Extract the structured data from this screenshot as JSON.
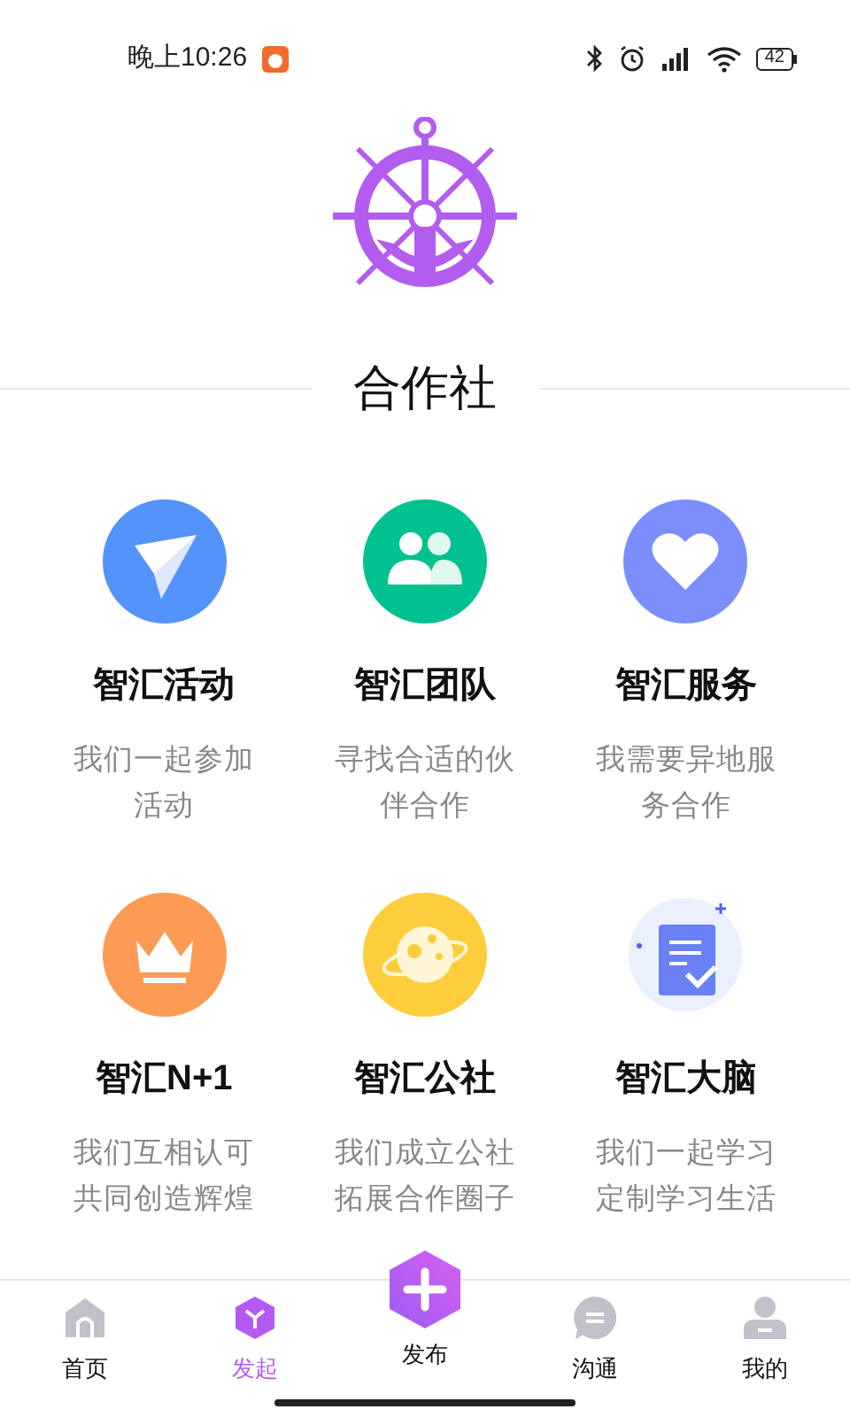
{
  "status_bar": {
    "time": "晚上10:26",
    "battery": "42"
  },
  "header": {
    "title": "合作社"
  },
  "features": [
    {
      "title": "智汇活动",
      "description": "我们一起参加活动"
    },
    {
      "title": "智汇团队",
      "description": "寻找合适的伙伴合作"
    },
    {
      "title": "智汇服务",
      "description": "我需要异地服务合作"
    },
    {
      "title": "智汇N+1",
      "description": "我们互相认可共同创造辉煌"
    },
    {
      "title": "智汇公社",
      "description": "我们成立公社拓展合作圈子"
    },
    {
      "title": "智汇大脑",
      "description": "我们一起学习定制学习生活"
    }
  ],
  "tab_bar": [
    {
      "kind": "home",
      "label": "首页",
      "selected": false
    },
    {
      "kind": "launch",
      "label": "发起",
      "selected": true
    },
    {
      "kind": "publish",
      "label": "发布",
      "selected": false
    },
    {
      "kind": "chat",
      "label": "沟通",
      "selected": false
    },
    {
      "kind": "profile",
      "label": "我的",
      "selected": false
    }
  ]
}
